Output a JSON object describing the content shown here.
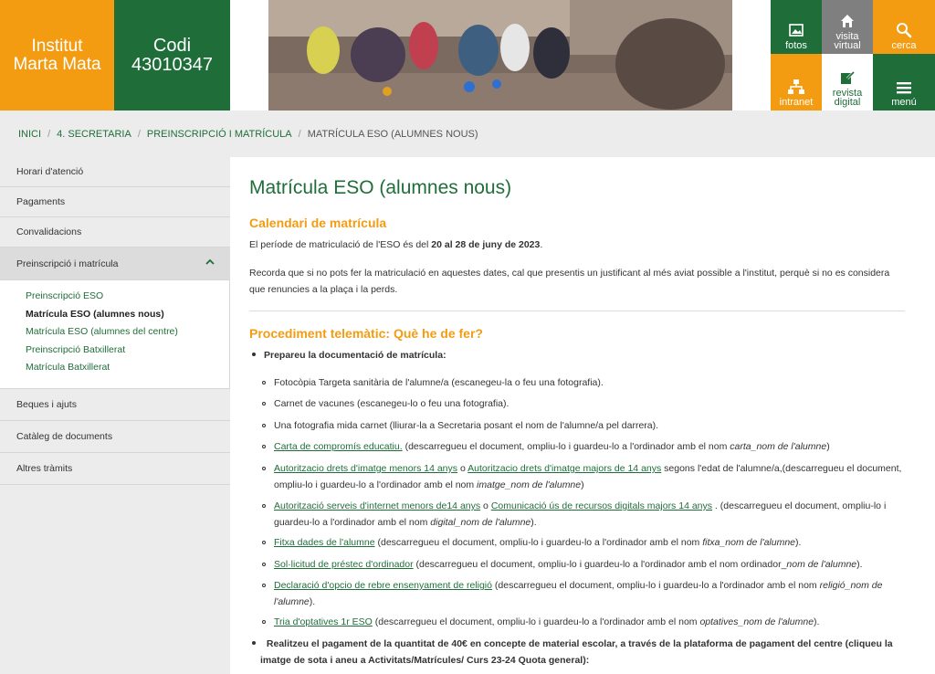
{
  "header": {
    "school_line1": "Institut",
    "school_line2": "Marta Mata",
    "codi_line1": "Codi",
    "codi_line2": "43010347",
    "tiles": {
      "fotos": "fotos",
      "visita_1": "visita",
      "visita_2": "virtual",
      "cerca": "cerca",
      "intranet": "intranet",
      "revista_1": "revista",
      "revista_2": "digital",
      "menu": "menú"
    },
    "colors": {
      "orange": "#f39c12",
      "green": "#1f6e3a",
      "grey": "#7f7f7f"
    }
  },
  "breadcrumb": {
    "items": [
      "Inici",
      "4. Secretaria",
      "Preinscripció i matrícula"
    ],
    "current": "Matrícula ESO (alumnes nous)"
  },
  "sidebar": {
    "items": [
      "Horari d'atenció",
      "Pagaments",
      "Convalidacions"
    ],
    "active": "Preinscripció i matrícula",
    "subitems": [
      "Preinscripció ESO",
      "Matrícula ESO (alumnes nous)",
      "Matrícula ESO (alumnes del centre)",
      "Preinscripció Batxillerat",
      "Matrícula Batxillerat"
    ],
    "items_after": [
      "Beques i ajuts",
      "Catàleg de documents",
      "Altres tràmits"
    ]
  },
  "main": {
    "title": "Matrícula ESO (alumnes nous)",
    "calendar_heading": "Calendari de matrícula",
    "period_text": "El període de matriculació de l'ESO és del ",
    "period_dates": "20 al 28 de juny de 2023",
    "period_end": ".",
    "reminder": "Recorda que si no pots fer la matriculació en aquestes dates, cal que presentis un justificant al més aviat possible a l'institut, perquè si no es considera que renuncies a la plaça i la perds.",
    "procedure_heading": "Procediment telemàtic: Què he de fer?",
    "prepare_label": "Prepareu la documentació de matrícula:",
    "docs": {
      "d1": "Fotocòpia Targeta sanitària de l'alumne/a (escanegeu-la o feu una fotografia).",
      "d2": "Carnet de vacunes (escanegeu-lo o feu una fotografia).",
      "d3": "Una fotografia mida carnet (lliurar-la a Secretaria posant el nom de l'alumne/a pel darrera).",
      "d4_link": "Carta de compromís educatiu.",
      "d4_text": " (descarregueu el document, ompliu-lo i guardeu-lo a l'ordinador amb el nom ",
      "d4_name": "carta_nom de l'alumne",
      "d4_end": ")",
      "d5_link1": "Autoritzacio drets d'imatge menors 14 anys",
      "d5_mid": " o ",
      "d5_link2": "Autoritzacio drets d'imatge majors de 14 anys",
      "d5_text": " segons l'edat de l'alumne/a,(descarregueu el document, ompliu-lo i guardeu-lo a l'ordinador amb el nom ",
      "d5_name": "imatge_nom de l'alumne",
      "d5_end": ")",
      "d6_link1": "Autorització serveis d'internet menors de14 anys",
      "d6_mid": " o ",
      "d6_link2": "Comunicació ús de recursos digitals majors 14 anys",
      "d6_text": " . (descarregueu el document, ompliu-lo i guardeu-lo a l'ordinador amb el nom ",
      "d6_name": "digital_nom de l'alumne",
      "d6_end": ").",
      "d7_link": "Fitxa dades de l'alumne",
      "d7_text": " (descarregueu el document, ompliu-lo i guardeu-lo a l'ordinador amb el nom ",
      "d7_name": "fitxa_nom de l'alumne",
      "d7_end": ").",
      "d8_link": "Sol·licitud de préstec d'ordinador",
      "d8_text": " (descarregueu el document, ompliu-lo i guardeu-lo a l'ordinador amb el nom ordinador_",
      "d8_name": "nom de l'alumne",
      "d8_end": ").",
      "d9_link": "Declaració d'opcio de rebre ensenyament de religió",
      "d9_text": " (descarregueu el document, ompliu-lo i guardeu-lo a l'ordinador amb el nom ",
      "d9_name": "religió_nom de l'alumne",
      "d9_end": ").",
      "d10_link": "Tria d'optatives 1r ESO",
      "d10_text": "  (descarregueu el document, ompliu-lo i guardeu-lo a l'ordinador amb el nom ",
      "d10_name": "optatives_nom de l'alumne",
      "d10_end": ")."
    },
    "payment": "Realitzeu el pagament  de la quantitat de 40€ en concepte de material escolar, a través de la plataforma de pagament del centre (cliqueu la imatge de sota i aneu a Activitats/Matrícules/ Curs 23-24 Quota general):"
  }
}
